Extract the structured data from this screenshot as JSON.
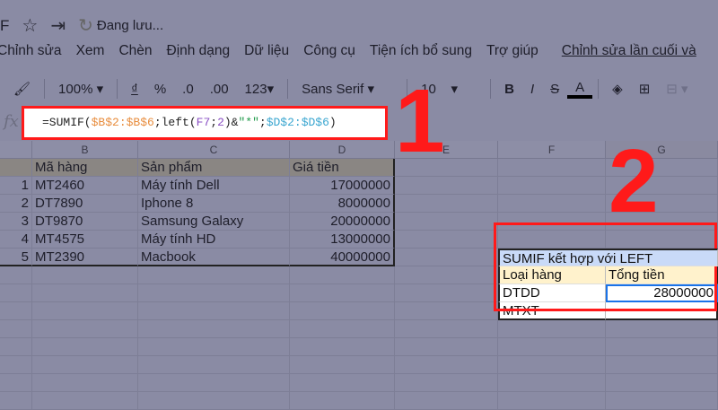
{
  "header": {
    "doc_initial": "F",
    "status": "Đang lưu..."
  },
  "menu": [
    "Chỉnh sửa",
    "Xem",
    "Chèn",
    "Định dạng",
    "Dữ liệu",
    "Công cụ",
    "Tiện ích bổ sung",
    "Trợ giúp"
  ],
  "menu_last_edit": "Chỉnh sửa lần cuối và",
  "toolbar": {
    "zoom": "100%",
    "currency": "₫",
    "percent": "%",
    "dec_less": ".0",
    "dec_more": ".00",
    "format": "123",
    "font": "Sans Serif",
    "size": "10",
    "bold": "B",
    "italic": "I",
    "strike": "S",
    "textcolor": "A"
  },
  "formula": {
    "fx": "fx",
    "p1": "=SUMIF(",
    "p2": "$B$2:$B$6",
    "p3": ";left(",
    "p4": "F7",
    "p5": ";",
    "p6": "2",
    "p7": ")&",
    "p8": "\"*\"",
    "p9": ";",
    "p10": "$D$2:$D$6",
    "p11": ")"
  },
  "annotations": {
    "one": "1",
    "two": "2"
  },
  "columns": [
    "B",
    "C",
    "D",
    "E",
    "F",
    "G"
  ],
  "table": {
    "headers": [
      "Mã hàng",
      "Sản phẩm",
      "Giá tiền"
    ],
    "rows": [
      [
        "1",
        "MT2460",
        "Máy tính Dell",
        "17000000"
      ],
      [
        "2",
        "DT7890",
        "Iphone 8",
        "8000000"
      ],
      [
        "3",
        "DT9870",
        "Samsung Galaxy",
        "20000000"
      ],
      [
        "4",
        "MT4575",
        "Máy tính HD",
        "13000000"
      ],
      [
        "5",
        "MT2390",
        "Macbook",
        "40000000"
      ]
    ]
  },
  "summary": {
    "title": "SUMIF kết hợp với LEFT",
    "h1": "Loại hàng",
    "h2": "Tổng tiền",
    "rows": [
      [
        "DTDD",
        "28000000"
      ],
      [
        "MTXT",
        ""
      ]
    ]
  }
}
